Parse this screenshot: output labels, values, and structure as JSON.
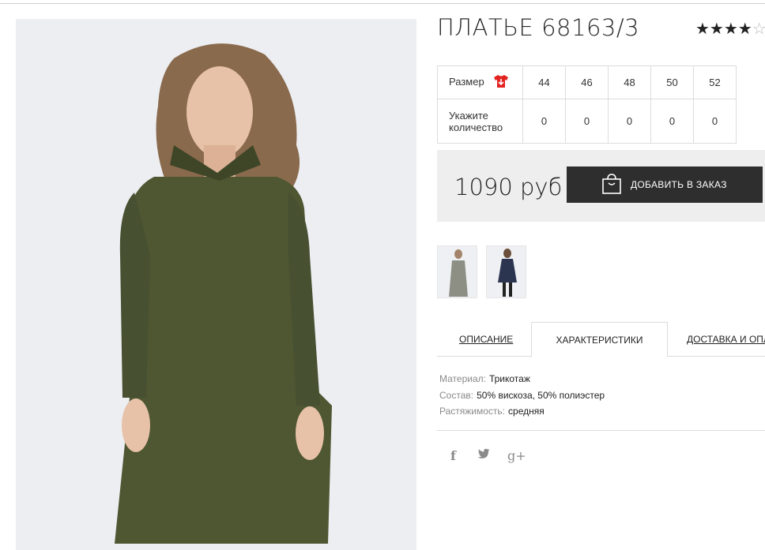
{
  "product": {
    "title": "ПЛАТЬЕ 68163/3",
    "rating_filled": "★★★★",
    "rating_partial": "☆"
  },
  "size_table": {
    "size_label": "Размер",
    "qty_label_1": "Укажите",
    "qty_label_2": "количество",
    "sizes": [
      "44",
      "46",
      "48",
      "50",
      "52"
    ],
    "quantities": [
      "0",
      "0",
      "0",
      "0",
      "0"
    ]
  },
  "price": {
    "value": "1090 руб",
    "order_button": "ДОБАВИТЬ В ЗАКАЗ"
  },
  "tabs": [
    {
      "label": "ОПИСАНИЕ"
    },
    {
      "label": "ХАРАКТЕРИСТИКИ"
    },
    {
      "label": "ДОСТАВКА И ОПЛАТА"
    }
  ],
  "characteristics": [
    {
      "key": "Материал:",
      "value": "Трикотаж"
    },
    {
      "key": "Состав:",
      "value": "50% вискоза, 50% полиэстер"
    },
    {
      "key": "Растяжимость:",
      "value": "средняя"
    }
  ],
  "social": {
    "facebook": "f",
    "twitter": "🐦",
    "googleplus": "g+"
  },
  "colors": {
    "dress_green": "#4e5632",
    "button_dark": "#2e2e2e",
    "price_bg": "#eeeeee",
    "tshirt_red": "#e32222"
  }
}
